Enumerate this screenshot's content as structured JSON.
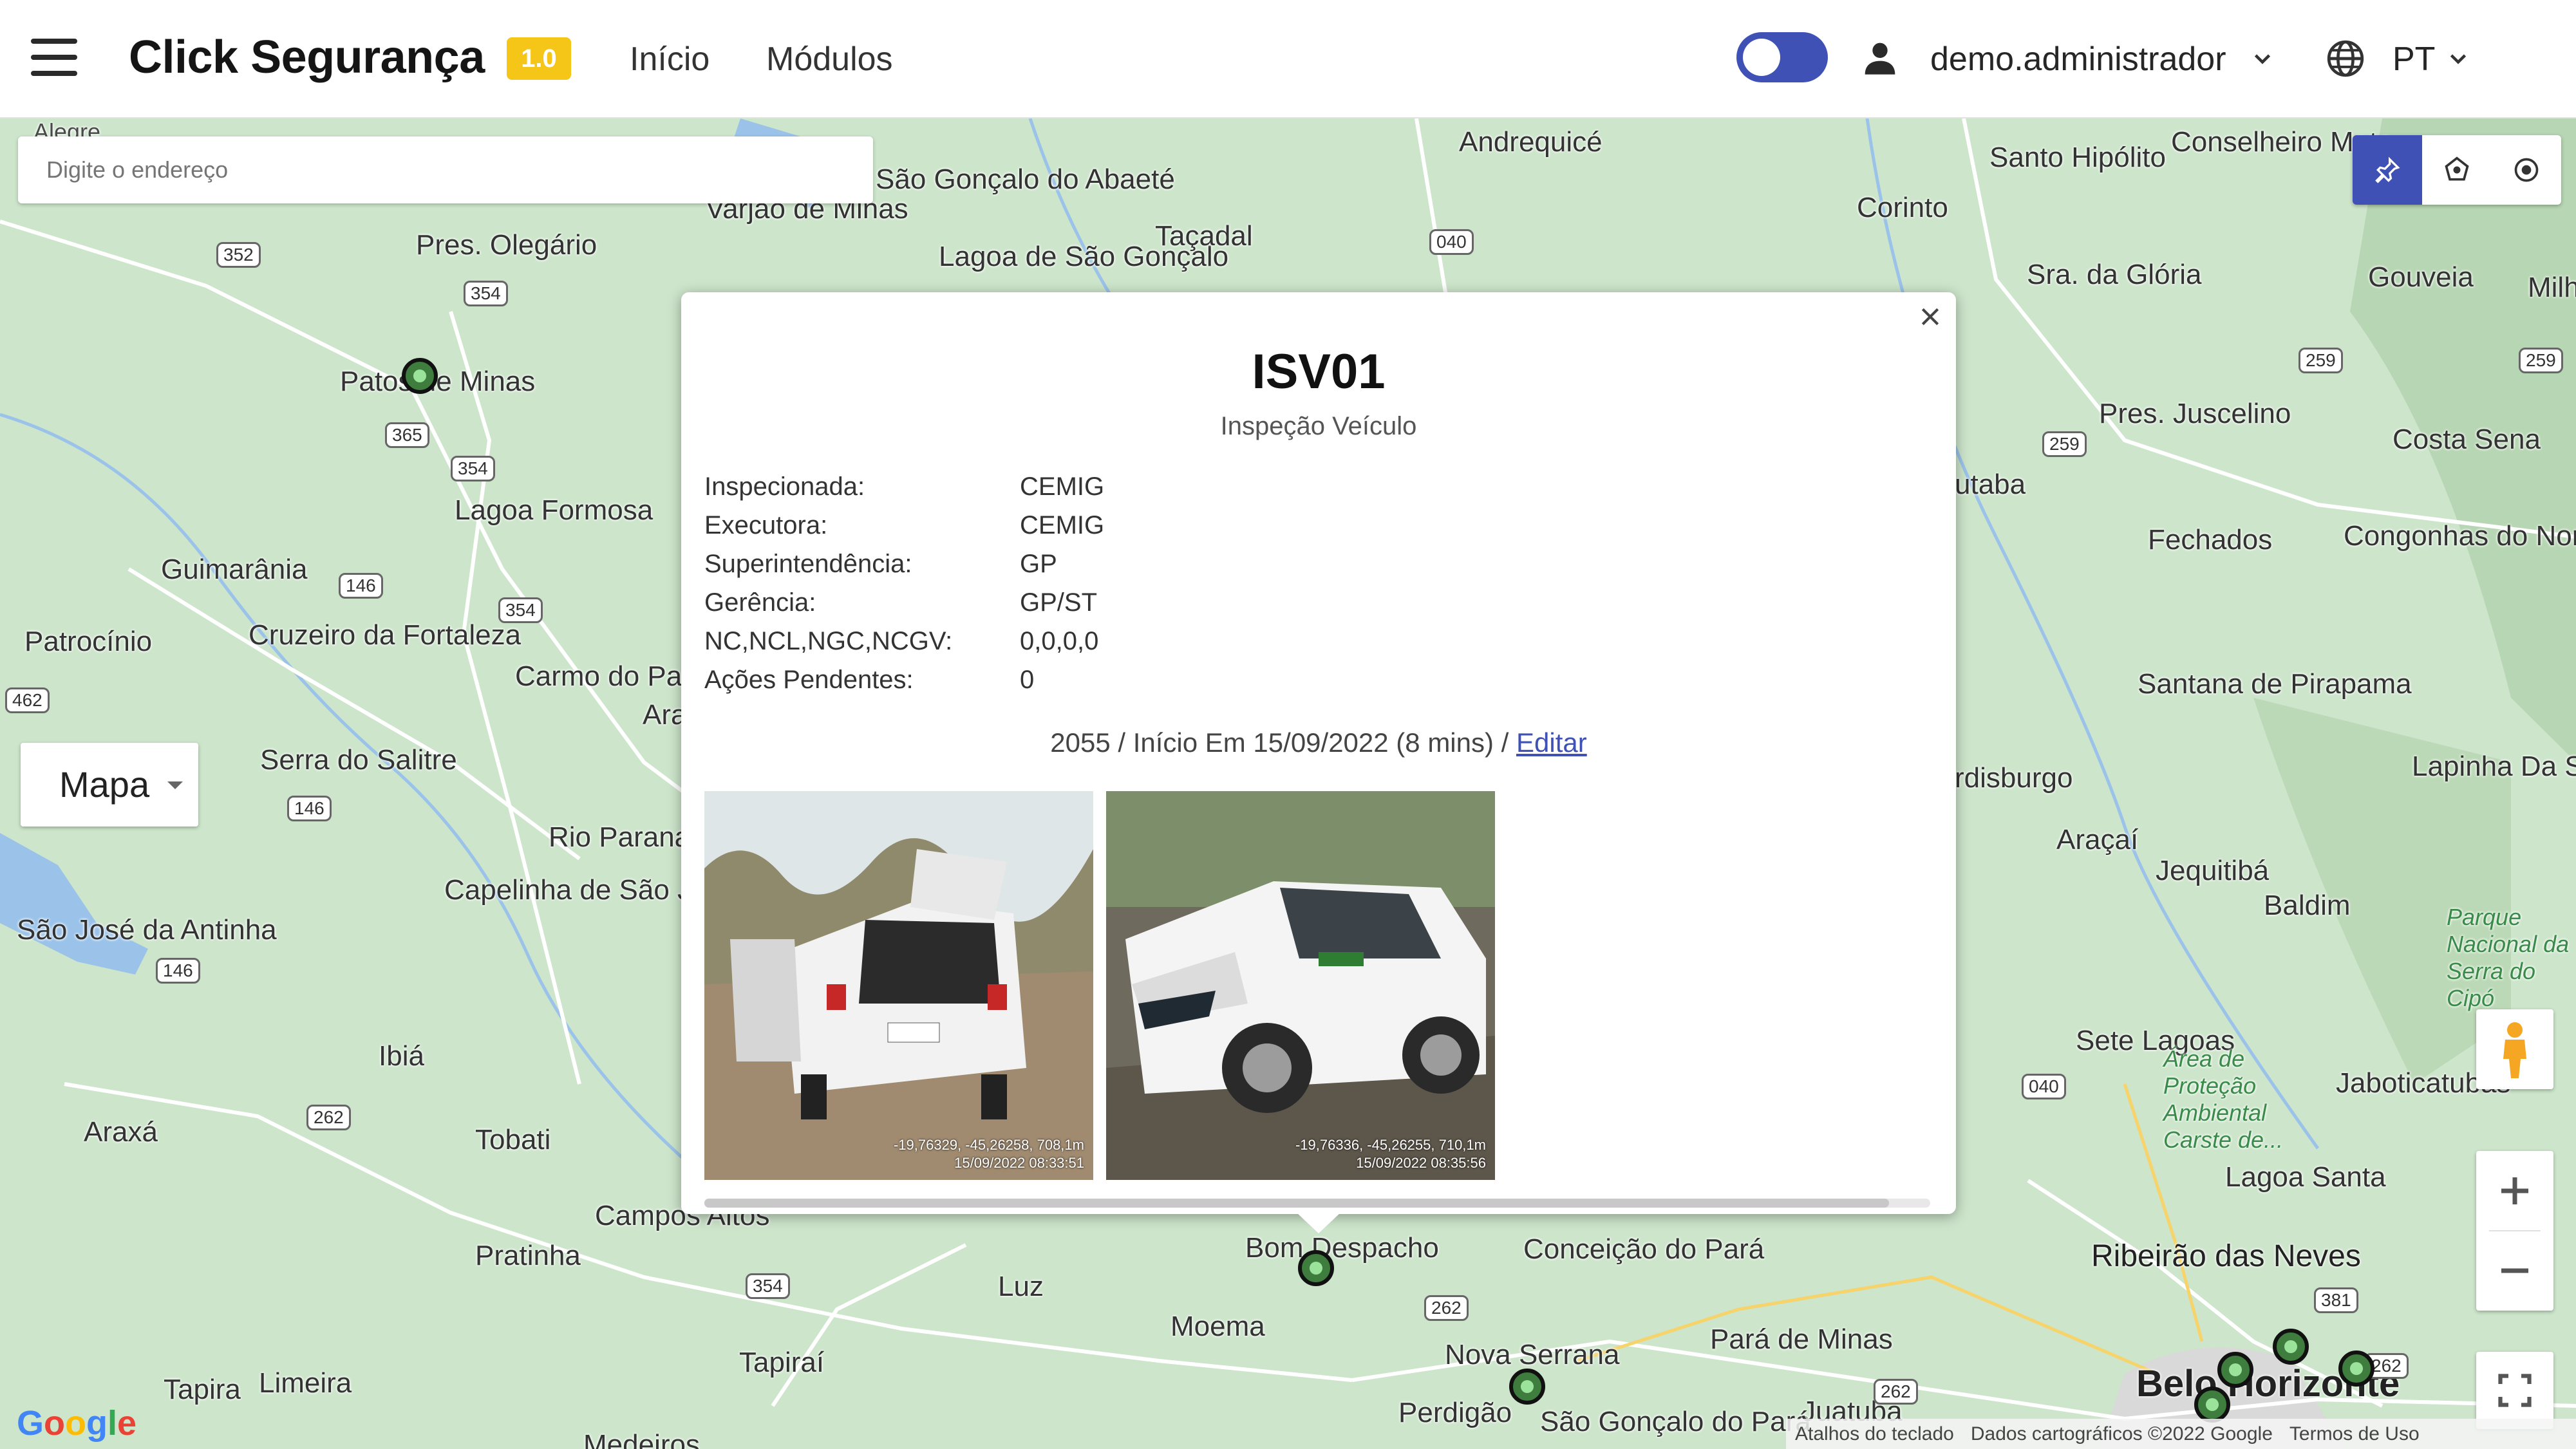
{
  "header": {
    "brand": "Click Segurança",
    "version": "1.0",
    "nav": [
      "Início",
      "Módulos"
    ],
    "user": "demo.administrador",
    "language": "PT"
  },
  "map": {
    "search_placeholder": "Digite o endereço",
    "map_type": "Mapa",
    "attribution": {
      "shortcuts": "Atalhos do teclado",
      "data": "Dados cartográficos ©2022 Google",
      "terms": "Termos de Uso"
    },
    "places": [
      "Alegre",
      "São Gonçalo do Abaeté",
      "Varjão de Minas",
      "Andrequicé",
      "Santo Hipólito",
      "Conselheiro Mata",
      "Pres. Olegário",
      "Lagoa de São Gonçalo",
      "Taçadal",
      "Corinto",
      "Sra. da Glória",
      "Gouveia",
      "Milho",
      "Patos de Minas",
      "Pres. Juscelino",
      "Costa Sena",
      "Lagoa Formosa",
      "Fechados",
      "Congonhas do Norte",
      "Guimarânia",
      "Patrocínio",
      "Cruzeiro da Fortaleza",
      "Carmo do Paranaíba",
      "Santana de Pirapama",
      "Serra do Salitre",
      "Rio Paranaíba",
      "Lapinha Da Serra",
      "Araçaí",
      "Jequitibá",
      "Baldim",
      "Capelinha de São João",
      "São José da Antinha",
      "Sete Lagoas",
      "Jaboticatubas",
      "Ibiá",
      "Araxá",
      "Tobati",
      "Campos Altos",
      "Pratinha",
      "Bom Despacho",
      "Conceição do Pará",
      "Ribeirão das Neves",
      "Lagoa Santa",
      "Luz",
      "Moema",
      "Tapiraí",
      "Nova Serrana",
      "Pará de Minas",
      "Tapira",
      "Limeira",
      "Perdigão",
      "São Gonçalo do Pará",
      "Juatuba",
      "Belo Horizonte",
      "Medeiros",
      "Parque Nacional da Serra do Cipó",
      "Área de Proteção Ambiental Carste de...",
      "utaba",
      "rdisburgo",
      "Ara"
    ],
    "roads": [
      "352",
      "354",
      "365",
      "354",
      "146",
      "354",
      "462",
      "146",
      "146",
      "262",
      "354",
      "262",
      "262",
      "040",
      "259",
      "259",
      "259",
      "040",
      "381",
      "262",
      "381"
    ]
  },
  "popup": {
    "title": "ISV01",
    "subtitle": "Inspeção Veículo",
    "fields": [
      {
        "label": "Inspecionada:",
        "value": "CEMIG"
      },
      {
        "label": "Executora:",
        "value": "CEMIG"
      },
      {
        "label": "Superintendência:",
        "value": "GP"
      },
      {
        "label": "Gerência:",
        "value": "GP/ST"
      },
      {
        "label": "NC,NCL,NGC,NCGV:",
        "value": "0,0,0,0"
      },
      {
        "label": "Ações Pendentes:",
        "value": "0"
      }
    ],
    "summary": "2055 / Início Em 15/09/2022 (8 mins) / ",
    "edit_link": "Editar",
    "photos": [
      {
        "coords": "-19,76329, -45,26258, 708,1m",
        "timestamp": "15/09/2022 08:33:51"
      },
      {
        "coords": "-19,76336, -45,26255, 710,1m",
        "timestamp": "15/09/2022 08:35:56"
      }
    ]
  },
  "colors": {
    "accent": "#3f51b5",
    "badge": "#f5c518",
    "map_land": "#cde5cb",
    "marker": "#3e7d3e"
  }
}
